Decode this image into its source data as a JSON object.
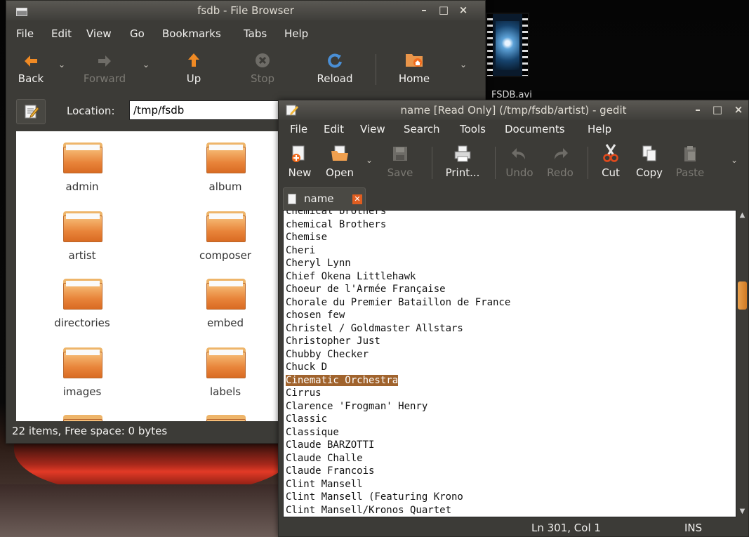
{
  "desktop": {
    "icon_label": "FSDB.avi"
  },
  "file_browser": {
    "title": "fsdb - File Browser",
    "window_buttons": [
      "–",
      "□",
      "×"
    ],
    "menu": [
      "File",
      "Edit",
      "View",
      "Go",
      "Bookmarks",
      "Tabs",
      "Help"
    ],
    "toolbar": {
      "back": "Back",
      "forward": "Forward",
      "up": "Up",
      "stop": "Stop",
      "reload": "Reload",
      "home": "Home"
    },
    "location": {
      "label": "Location:",
      "value": "/tmp/fsdb"
    },
    "folders": [
      "admin",
      "album",
      "artist",
      "composer",
      "directories",
      "embed",
      "images",
      "labels"
    ],
    "status": "22 items, Free space: 0 bytes"
  },
  "gedit": {
    "title": "name [Read Only] (/tmp/fsdb/artist) - gedit",
    "window_buttons": [
      "–",
      "□",
      "×"
    ],
    "menu": [
      "File",
      "Edit",
      "View",
      "Search",
      "Tools",
      "Documents",
      "Help"
    ],
    "toolbar": {
      "new": "New",
      "open": "Open",
      "save": "Save",
      "print": "Print...",
      "undo": "Undo",
      "redo": "Redo",
      "cut": "Cut",
      "copy": "Copy",
      "paste": "Paste"
    },
    "tab_label": "name",
    "lines": [
      "chemical brothers",
      "chemical Brothers",
      "Chemise",
      "Cheri",
      "Cheryl Lynn",
      "Chief Okena Littlehawk",
      "Choeur de l'Armée Française",
      "Chorale du Premier Bataillon de France",
      "chosen few",
      "Christel / Goldmaster Allstars",
      "Christopher Just",
      "Chubby Checker",
      "Chuck D",
      "Cinematic Orchestra",
      "Cirrus",
      "Clarence 'Frogman' Henry",
      "Classic",
      "Classique",
      "Claude BARZOTTI",
      "Claude Challe",
      "Claude Francois",
      "Clint Mansell",
      "Clint Mansell (Featuring Krono",
      "Clint Mansell/Kronos Quartet"
    ],
    "selected_line": "Cinematic Orchestra",
    "status": {
      "position": "Ln 301, Col 1",
      "mode": "INS"
    }
  },
  "colors": {
    "window_bg": "#3c3b37",
    "accent_orange": "#e05d20",
    "selection": "#a0632d"
  }
}
